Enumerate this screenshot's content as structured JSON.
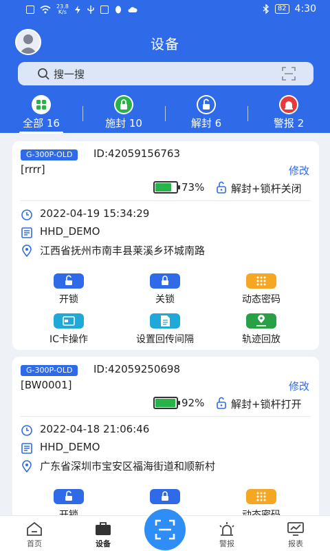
{
  "status_bar": {
    "network_speed_value": "23.8",
    "network_speed_unit": "K/s",
    "battery": "82",
    "time": "4:30"
  },
  "header": {
    "title": "设备"
  },
  "search": {
    "placeholder": "搜一搜"
  },
  "tabs": [
    {
      "label": "全部 16",
      "icon": "grid-icon",
      "icon_color": "#27b24a",
      "active": true
    },
    {
      "label": "施封 10",
      "icon": "lock-icon",
      "icon_color": "#27b24a",
      "active": false
    },
    {
      "label": "解封 6",
      "icon": "unlock-icon",
      "icon_color": "#2f6be8",
      "active": false
    },
    {
      "label": "警报 2",
      "icon": "alarm-icon",
      "icon_color": "#e83a3a",
      "active": false
    }
  ],
  "devices": [
    {
      "model": "G-300P-OLD",
      "id": "ID:42059156763",
      "name": "[rrrr]",
      "edit_label": "修改",
      "battery_percent": 73,
      "battery_label": "73%",
      "lock_status": "解封+锁杆关闭",
      "time": "2022-04-19 15:34:29",
      "company": "HHD_DEMO",
      "address": "江西省抚州市南丰县莱溪乡环城南路"
    },
    {
      "model": "G-300P-OLD",
      "id": "ID:42059250698",
      "name": "[BW0001]",
      "edit_label": "修改",
      "battery_percent": 92,
      "battery_label": "92%",
      "lock_status": "解封+锁杆打开",
      "time": "2022-04-18 21:06:46",
      "company": "HHD_DEMO",
      "address": "广东省深圳市宝安区福海街道和顺新村"
    }
  ],
  "actions": [
    {
      "label": "开锁",
      "icon": "unlock-icon",
      "color": "#2f6be8"
    },
    {
      "label": "关锁",
      "icon": "lock-icon",
      "color": "#2f6be8"
    },
    {
      "label": "动态密码",
      "icon": "keypad-icon",
      "color": "#f5a623"
    },
    {
      "label": "IC卡操作",
      "icon": "card-icon",
      "color": "#1fa8d8"
    },
    {
      "label": "设置回传间隔",
      "icon": "document-icon",
      "color": "#1fa8d8"
    },
    {
      "label": "轨迹回放",
      "icon": "route-icon",
      "color": "#27a046"
    }
  ],
  "actions_visible_card2": [
    {
      "label": "开锁"
    },
    {
      "label": "关锁"
    },
    {
      "label": "动态密码"
    }
  ],
  "bottom_nav": [
    {
      "label": "首页",
      "icon": "home-icon"
    },
    {
      "label": "设备",
      "icon": "briefcase-icon",
      "active": true
    },
    {
      "label": "警报",
      "icon": "alarm-light-icon"
    },
    {
      "label": "报表",
      "icon": "chart-monitor-icon"
    }
  ]
}
